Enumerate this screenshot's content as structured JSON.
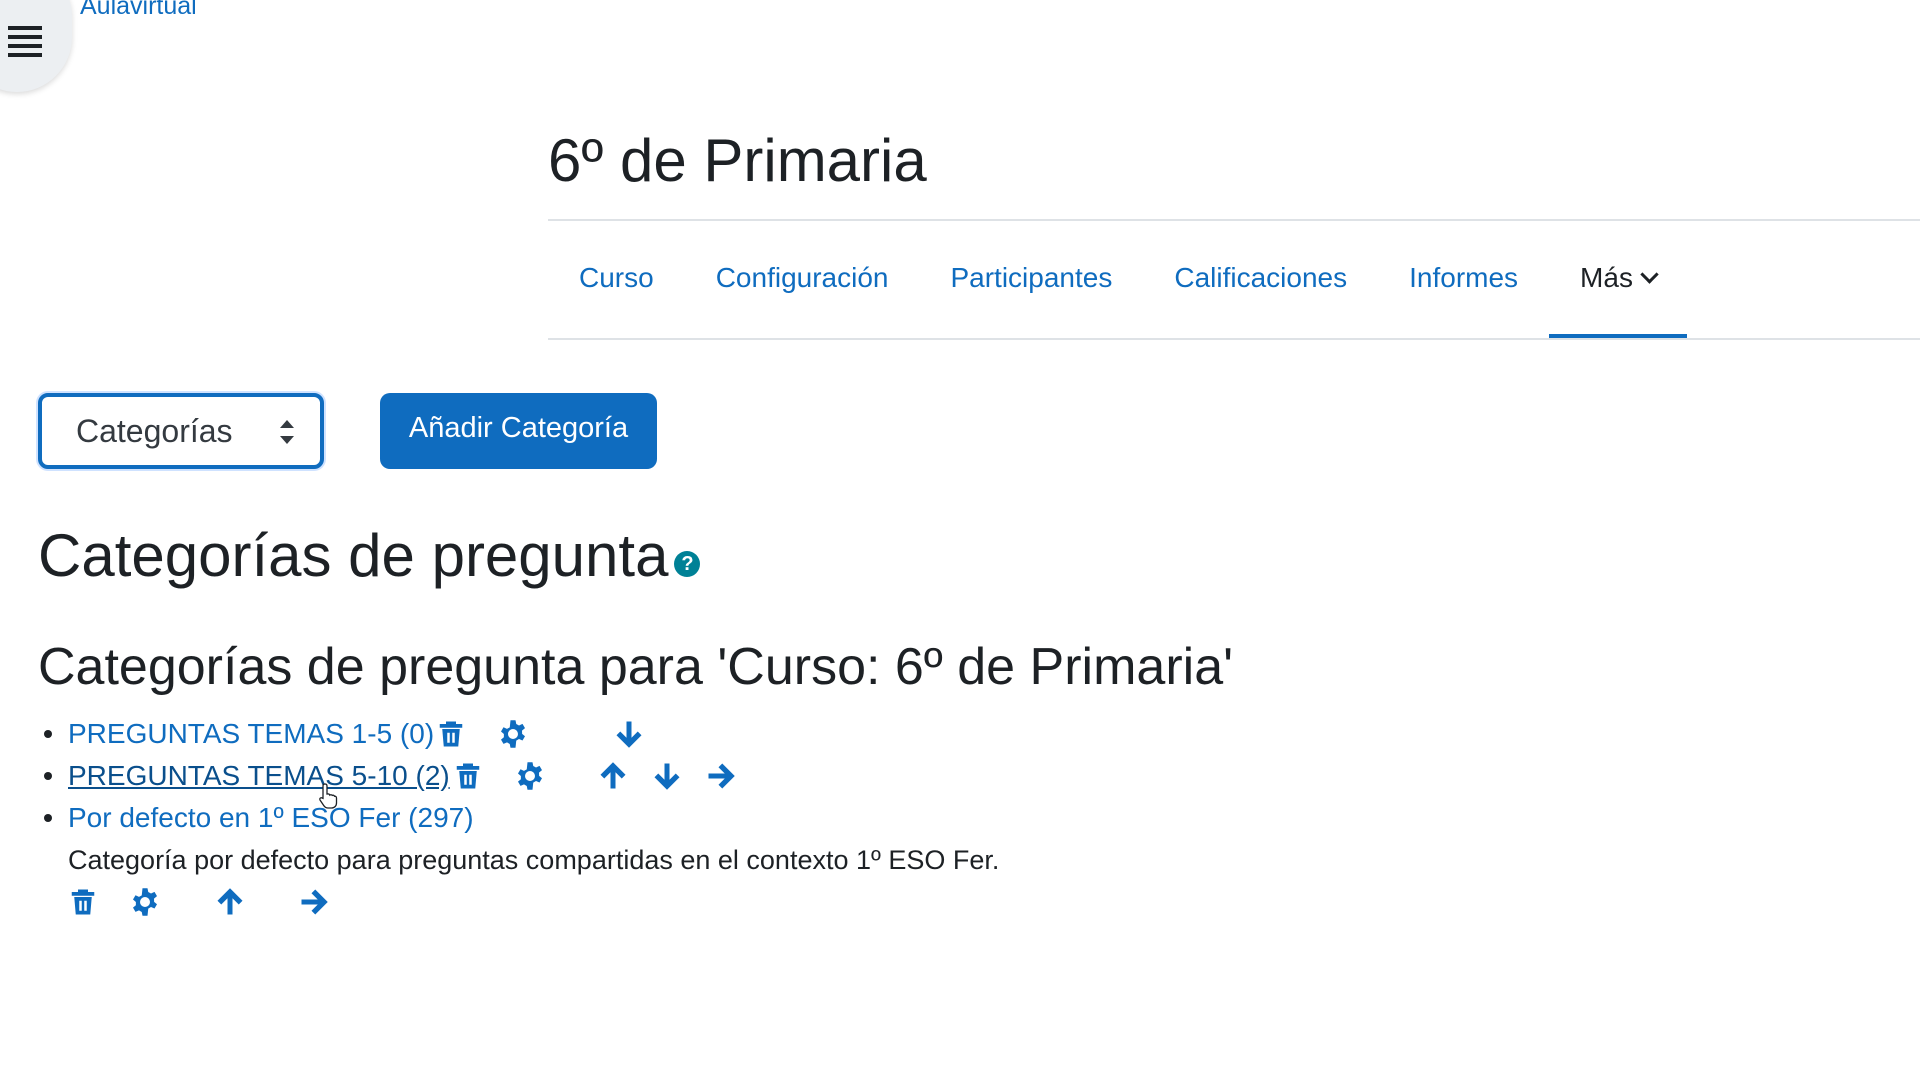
{
  "site": {
    "breadcrumb": "Aulavirtual"
  },
  "course": {
    "title": "6º de Primaria"
  },
  "nav": {
    "tabs": [
      "Curso",
      "Configuración",
      "Participantes",
      "Calificaciones",
      "Informes"
    ],
    "more_label": "Más",
    "active": "Más"
  },
  "actions": {
    "select_value": "Categorías",
    "add_button": "Añadir Categoría"
  },
  "headings": {
    "page": "Categorías de pregunta",
    "section": "Categorías de pregunta para 'Curso: 6º de Primaria'"
  },
  "categories": [
    {
      "name": "PREGUNTAS TEMAS 1-5 (0)",
      "actions": [
        "trash-icon",
        "gear-icon",
        "arrow-down-icon"
      ]
    },
    {
      "name": "PREGUNTAS TEMAS 5-10 (2)",
      "actions": [
        "trash-icon",
        "gear-icon",
        "arrow-up-icon",
        "arrow-down-icon",
        "arrow-right-icon"
      ]
    },
    {
      "name": "Por defecto en 1º ESO Fer (297)",
      "description": "Categoría por defecto para preguntas compartidas en el contexto 1º ESO Fer.",
      "actions": [
        "trash-icon",
        "gear-icon",
        "arrow-up-icon",
        "arrow-right-icon"
      ]
    }
  ],
  "colors": {
    "link": "#0f6cbf",
    "help_icon": "#008196",
    "text": "#1d2125"
  }
}
